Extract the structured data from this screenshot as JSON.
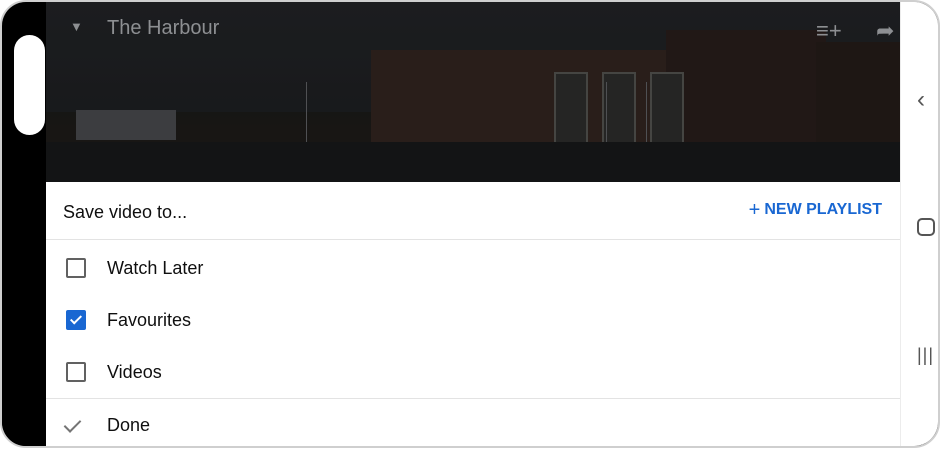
{
  "video": {
    "title": "The Harbour",
    "add_icon": "playlist-add-icon",
    "share_icon": "share-icon"
  },
  "sheet": {
    "title": "Save video to...",
    "new_playlist_label": "NEW PLAYLIST",
    "plus_symbol": "+",
    "items": [
      {
        "label": "Watch Later",
        "checked": false
      },
      {
        "label": "Favourites",
        "checked": true
      },
      {
        "label": "Videos",
        "checked": false
      }
    ],
    "done_label": "Done"
  },
  "nav": {
    "back_icon": "back-chevron-icon",
    "home_icon": "home-icon",
    "recents_icon": "recents-icon"
  },
  "colors": {
    "accent": "#1967d2"
  }
}
